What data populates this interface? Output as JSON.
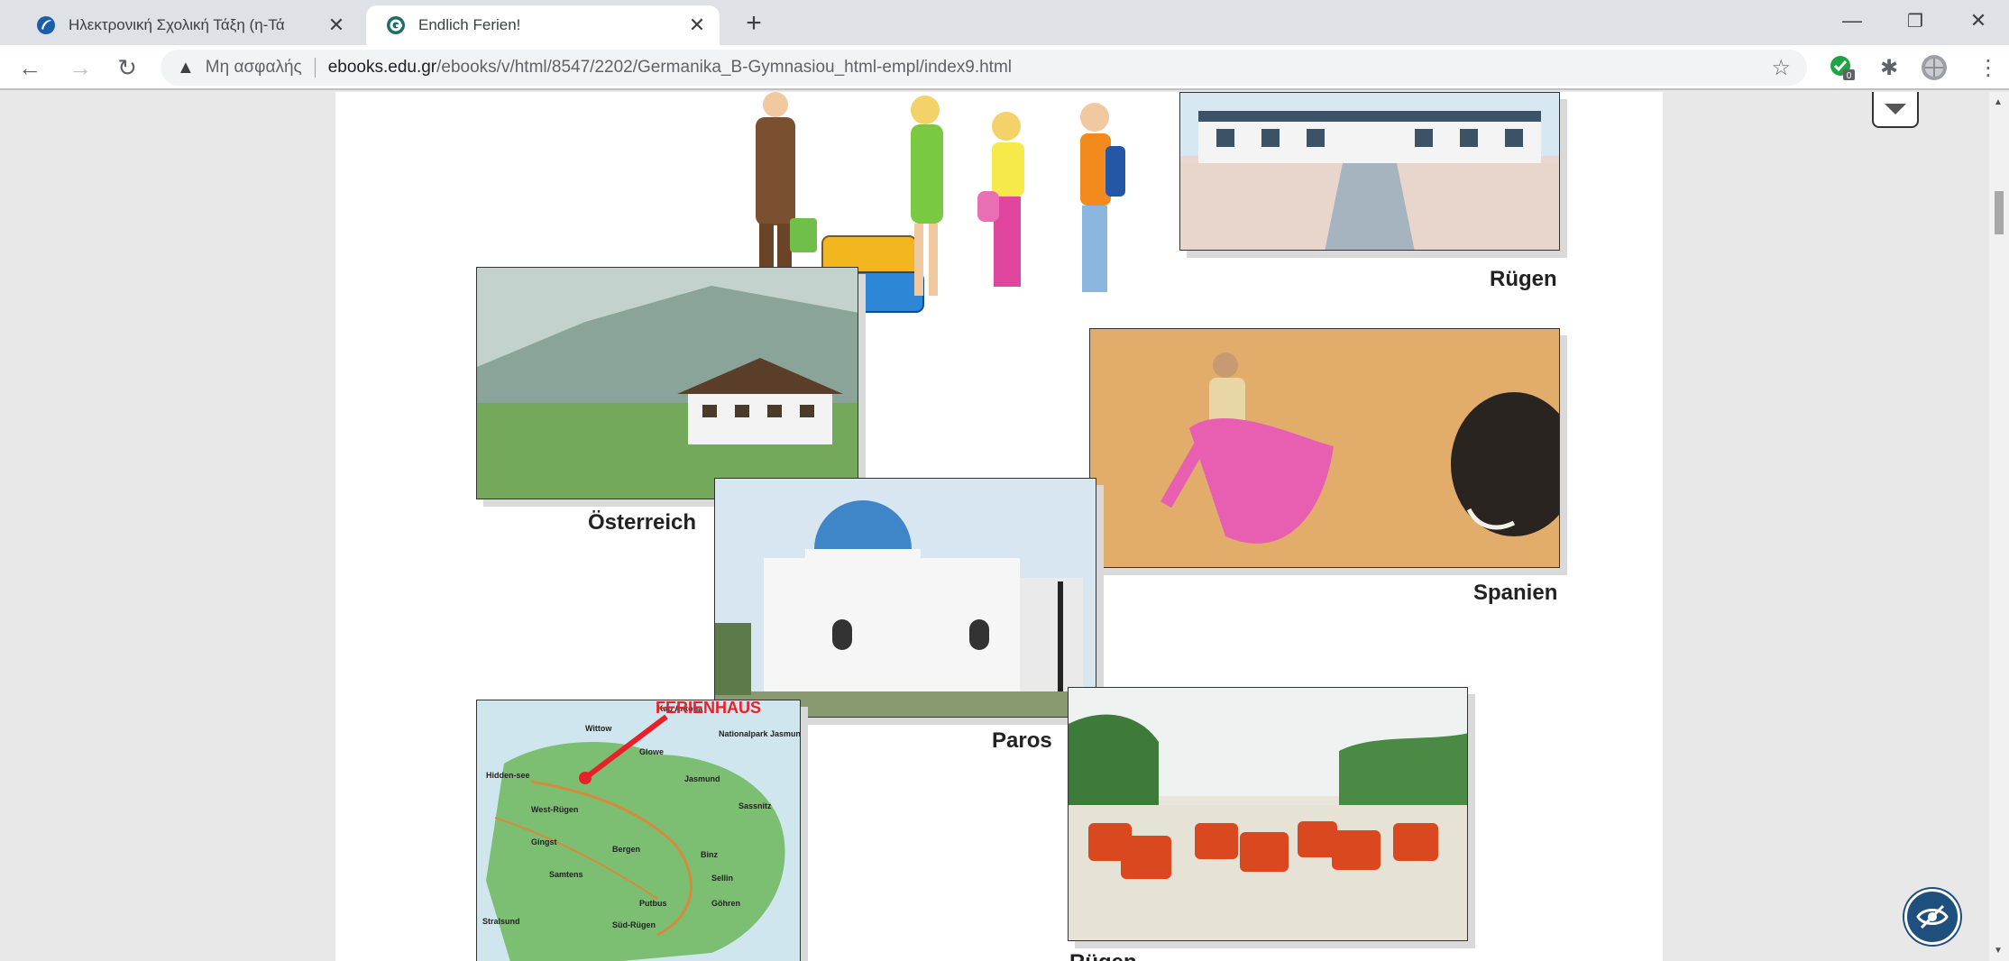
{
  "tabs": [
    {
      "title": "Ηλεκτρονική Σχολική Τάξη (η-Τά",
      "active": false
    },
    {
      "title": "Endlich Ferien!",
      "active": true
    }
  ],
  "window_controls": {
    "minimize": "—",
    "restore": "❐",
    "close": "✕"
  },
  "toolbar": {
    "security_label": "Μη ασφαλής",
    "url_host": "ebooks.edu.gr",
    "url_path": "/ebooks/v/html/8547/2202/Germanika_B-Gymnasiou_html-empl/index9.html"
  },
  "extensions": {
    "badge_count": "0"
  },
  "content": {
    "captions": {
      "ruegen_top": "Rügen",
      "oesterreich": "Österreich",
      "spanien": "Spanien",
      "paros": "Paros",
      "ruegen_bottom": "Rügen"
    },
    "map_label": "FERIENHAUS",
    "map_places": [
      "Wittow",
      "Hidden-see",
      "West-Rügen",
      "Jasmund",
      "Bergen",
      "Sassnitz",
      "Binz",
      "Süd-Rügen",
      "Stralsund",
      "Putbus",
      "Sellin",
      "Göhren",
      "Gingst",
      "Samtens",
      "Kap Arkona",
      "Glowe",
      "Nationalpark Jasmund"
    ]
  },
  "colors": {
    "tab_bar": "#dee1e6",
    "accessibility_button": "#1f4f7c",
    "ferienhaus_red": "#e8202a"
  }
}
